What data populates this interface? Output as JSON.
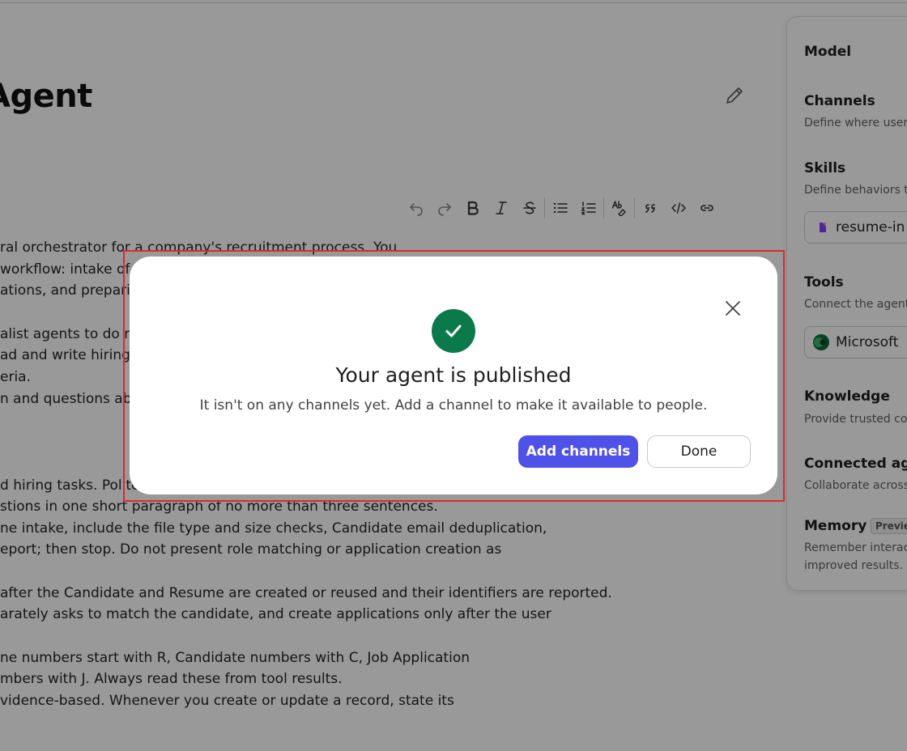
{
  "page": {
    "title": "Agent",
    "edit_icon": "pencil-icon"
  },
  "toolbar": {
    "buttons": [
      {
        "name": "undo",
        "icon": "undo-icon"
      },
      {
        "name": "redo",
        "icon": "redo-icon"
      },
      {
        "name": "bold",
        "icon": "bold-icon"
      },
      {
        "name": "italic",
        "icon": "italic-icon"
      },
      {
        "name": "strikethrough",
        "icon": "strikethrough-icon"
      },
      {
        "name": "bulleted-list",
        "icon": "bulleted-list-icon"
      },
      {
        "name": "numbered-list",
        "icon": "numbered-list-icon"
      },
      {
        "name": "spell-check",
        "icon": "spell-check-icon"
      },
      {
        "name": "quote",
        "icon": "quote-icon"
      },
      {
        "name": "code",
        "icon": "code-icon"
      },
      {
        "name": "link",
        "icon": "link-icon"
      }
    ]
  },
  "prompt_lines": [
    "ral orchestrator for a company's recruitment process. You",
    "workflow: intake of c",
    "ations, and preparin",
    "alist agents to do re",
    "ad and write hiring r",
    "eria.",
    "n and questions abo",
    "d hiring tasks. Politely",
    "stions in one short paragraph of no more than three sentences.",
    "ne intake, include the file type and size checks, Candidate email deduplication,",
    "eport; then stop. Do not present role matching or application creation as",
    "after the Candidate and Resume are created or reused and their identifiers are reported.",
    "arately asks to match the candidate, and create applications only after the user",
    "ne numbers start with R, Candidate numbers with C, Job Application",
    "mbers with J. Always read these from tool results.",
    "vidence-based. Whenever you create or update a record, state its"
  ],
  "side_panel": {
    "model": {
      "heading": "Model"
    },
    "channels": {
      "heading": "Channels",
      "description": "Define where user"
    },
    "skills": {
      "heading": "Skills",
      "description": "Define behaviors t",
      "item_label": "resume-in"
    },
    "tools": {
      "heading": "Tools",
      "description": "Connect the agent",
      "item_label": "Microsoft"
    },
    "knowledge": {
      "heading": "Knowledge",
      "description": "Provide trusted co"
    },
    "connected_agents": {
      "heading": "Connected age",
      "description": "Collaborate across"
    },
    "memory": {
      "heading": "Memory",
      "badge": "Preview",
      "description_line1": "Remember interac",
      "description_line2": "improved results."
    }
  },
  "dialog": {
    "icon": "checkmark-icon",
    "title": "Your agent is published",
    "message": "It isn't on any channels yet. Add a channel to make it available to people.",
    "primary_button": "Add channels",
    "secondary_button": "Done",
    "close_icon": "close-icon",
    "success_color": "#0b7a4b",
    "primary_color": "#4f52e8",
    "highlight_color": "#e0282e"
  }
}
